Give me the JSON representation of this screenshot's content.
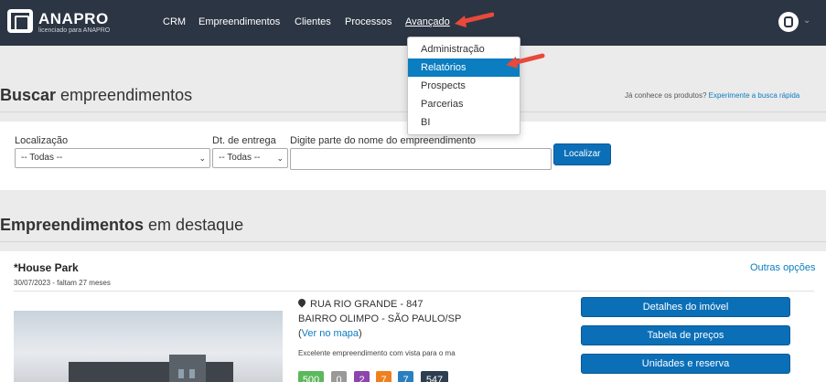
{
  "brand": {
    "name": "ANAPRO",
    "tagline": "licenciado para ANAPRO"
  },
  "nav": {
    "items": [
      "CRM",
      "Empreendimentos",
      "Clientes",
      "Processos",
      "Avançado"
    ],
    "active": "Avançado"
  },
  "dropdown": {
    "items": [
      "Administração",
      "Relatórios",
      "Prospects",
      "Parcerias",
      "BI"
    ],
    "selected": "Relatórios"
  },
  "search": {
    "title_bold": "Buscar",
    "title_rest": " empreendimentos",
    "hint_text": "Já conhece os produtos? ",
    "hint_link": "Experimente a busca rápida",
    "location_label": "Localização",
    "location_value": "-- Todas --",
    "delivery_label": "Dt. de entrega",
    "delivery_value": "-- Todas --",
    "name_label": "Digite parte do nome do empreendimento",
    "name_value": "",
    "button": "Localizar"
  },
  "featured": {
    "title_bold": "Empreendimentos",
    "title_rest": " em destaque"
  },
  "card": {
    "title": "*House Park",
    "date": "30/07/2023 - faltam 27 meses",
    "options": "Outras opções",
    "address_line1": "RUA RIO GRANDE - 847",
    "address_line2": "BAIRRO OLIMPO - SÃO PAULO/SP",
    "map_open": "(",
    "map_link": "Ver no mapa",
    "map_close": ")",
    "description": "Excelente empreendimento com vista para o ma",
    "badges": [
      {
        "value": "500",
        "color": "#5cb85c"
      },
      {
        "value": "0",
        "color": "#999999"
      },
      {
        "value": "2",
        "color": "#8e44ad"
      },
      {
        "value": "7",
        "color": "#f0801e"
      },
      {
        "value": "7",
        "color": "#2a7fc1"
      },
      {
        "value": "547",
        "color": "#2c3e50"
      }
    ],
    "actions": [
      "Detalhes do imóvel",
      "Tabela de preços",
      "Unidades e reserva"
    ]
  },
  "colors": {
    "topbar": "#2c3543",
    "accent": "#0b7dc1",
    "button": "#0b6fb8",
    "arrow": "#e8493a"
  }
}
